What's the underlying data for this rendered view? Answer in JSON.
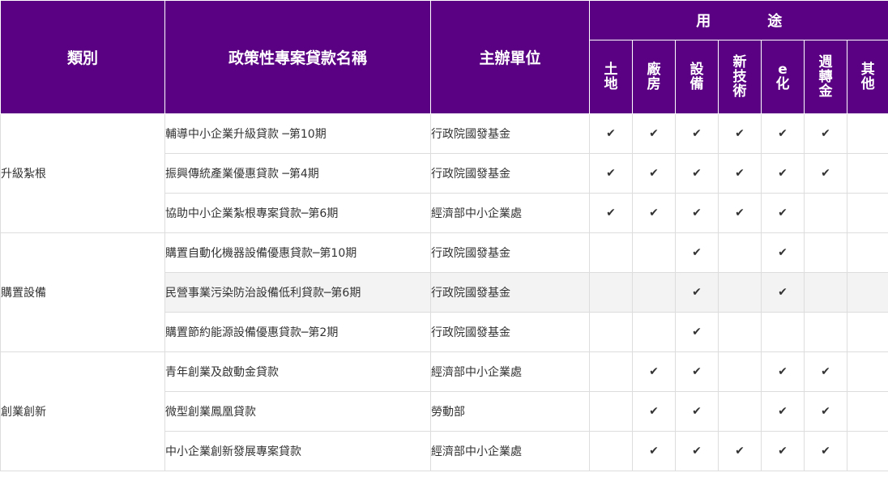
{
  "header": {
    "category": "類別",
    "name": "政策性專案貸款名稱",
    "org": "主辦單位",
    "usage_words": [
      "用",
      "途"
    ],
    "usage_columns": [
      [
        "土",
        "地"
      ],
      [
        "廠",
        "房"
      ],
      [
        "設",
        "備"
      ],
      [
        "新",
        "技",
        "術"
      ],
      [
        "e",
        "化"
      ],
      [
        "週",
        "轉",
        "金"
      ],
      [
        "其",
        "他"
      ]
    ]
  },
  "check_glyph": "✔",
  "groups": [
    {
      "category": "升級紮根",
      "rows": [
        {
          "name": "輔導中小企業升級貸款 ─第10期",
          "org": "行政院國發基金",
          "marks": [
            true,
            true,
            true,
            true,
            true,
            true,
            false
          ]
        },
        {
          "name": "振興傳統產業優惠貸款 ─第4期",
          "org": "行政院國發基金",
          "marks": [
            true,
            true,
            true,
            true,
            true,
            true,
            false
          ]
        },
        {
          "name": "協助中小企業紮根專案貸款─第6期",
          "org": "經濟部中小企業處",
          "marks": [
            true,
            true,
            true,
            true,
            true,
            false,
            false
          ]
        }
      ]
    },
    {
      "category": "購置設備",
      "rows": [
        {
          "name": "購置自動化機器設備優惠貸款─第10期",
          "org": "行政院國發基金",
          "marks": [
            false,
            false,
            true,
            false,
            true,
            false,
            false
          ]
        },
        {
          "name": "民營事業污染防治設備低利貸款─第6期",
          "org": "行政院國發基金",
          "marks": [
            false,
            false,
            true,
            false,
            true,
            false,
            false
          ]
        },
        {
          "name": "購置節約能源設備優惠貸款─第2期",
          "org": "行政院國發基金",
          "marks": [
            false,
            false,
            true,
            false,
            false,
            false,
            false
          ]
        }
      ]
    },
    {
      "category": "創業創新",
      "rows": [
        {
          "name": "青年創業及啟動金貸款",
          "org": "經濟部中小企業處",
          "marks": [
            false,
            true,
            true,
            false,
            true,
            true,
            false
          ]
        },
        {
          "name": "微型創業鳳凰貸款",
          "org": "勞動部",
          "marks": [
            false,
            true,
            true,
            false,
            true,
            true,
            false
          ]
        },
        {
          "name": "中小企業創新發展專案貸款",
          "org": "經濟部中小企業處",
          "marks": [
            false,
            true,
            true,
            true,
            true,
            true,
            false
          ]
        }
      ]
    }
  ]
}
